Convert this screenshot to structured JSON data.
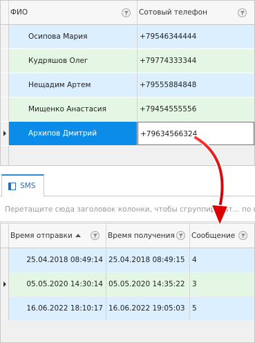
{
  "contacts_grid": {
    "columns": [
      "ФИО",
      "Сотовый телефон"
    ],
    "rows": [
      {
        "name": "Осипова Мария",
        "phone": "+79546344444"
      },
      {
        "name": "Кудряшов Олег",
        "phone": "+79774333344"
      },
      {
        "name": "Нещадим Артем",
        "phone": "+79555884848"
      },
      {
        "name": "Мищенко Анастасия",
        "phone": "+79454555556"
      },
      {
        "name": "Архипов Дмитрий",
        "phone": "+79634566324"
      }
    ],
    "selected_row": 4
  },
  "tabs": [
    {
      "label": "SMS",
      "icon": "table-icon",
      "active": true
    }
  ],
  "group_panel": {
    "text": "Перетащите сюда заголовок колонки, чтобы сгруппироват... по ней"
  },
  "sms_grid": {
    "columns": [
      "Время отправки",
      "Время получения",
      "Сообщение"
    ],
    "sort_column": 0,
    "sort_direction": "ascending",
    "rows": [
      {
        "sent": "25.04.2018 08:49:14",
        "received": "25.04.2018 08:49:15",
        "message": "4"
      },
      {
        "sent": "05.05.2020 14:30:14",
        "received": "05.05.2020 14:35:22",
        "message": "3"
      },
      {
        "sent": "16.06.2022 18:10:17",
        "received": "16.06.2022 19:05:03",
        "message": "5"
      }
    ],
    "current_row": 1
  },
  "colors": {
    "row_blue": "#dcefff",
    "row_green": "#e4f7e4",
    "selection": "#0a8ce8",
    "arrow": "#e60000",
    "tab_accent": "#2a8bd8"
  }
}
